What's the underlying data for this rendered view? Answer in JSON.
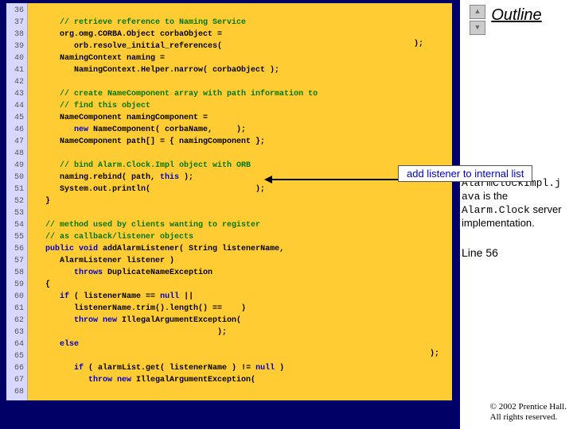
{
  "outline_label": "Outline",
  "gutter": "36\n37\n38\n39\n40\n41\n42\n43\n44\n45\n46\n47\n48\n49\n50\n51\n52\n53\n54\n55\n56\n57\n58\n59\n60\n61\n62\n63\n64\n65\n66\n67\n68",
  "callout_text": "add listener to internal list",
  "annotation_parts": {
    "p1": "AlarmClockImpl.j",
    "p2": "ava",
    "p3": " is the ",
    "p4": "Alarm.Clock",
    "p5": " server implementation."
  },
  "line_ref": "Line 56",
  "copyright_1": "© 2002 Prentice Hall.",
  "copyright_2": "All rights reserved.",
  "scroll_up": "▲",
  "scroll_down": "▼",
  "trail": ");",
  "trail2": ");",
  "code_lines": [
    {
      "pre": "",
      "cls": "",
      "txt": ""
    },
    {
      "pre": "      ",
      "cls": "cm",
      "txt": "// retrieve reference to Naming Service"
    },
    {
      "pre": "      ",
      "cls": "",
      "txt": "org.omg.CORBA.Object corbaObject ="
    },
    {
      "pre": "         ",
      "cls": "",
      "txt": "orb.resolve_initial_references("
    },
    {
      "pre": "      ",
      "cls": "",
      "txt": "NamingContext naming ="
    },
    {
      "pre": "         ",
      "cls": "",
      "txt": "NamingContext.Helper.narrow( corbaObject );"
    },
    {
      "pre": "",
      "cls": "",
      "txt": ""
    },
    {
      "pre": "      ",
      "cls": "cm",
      "txt": "// create NameComponent array with path information to"
    },
    {
      "pre": "      ",
      "cls": "cm",
      "txt": "// find this object"
    },
    {
      "pre": "      ",
      "cls": "",
      "txt": "NameComponent namingComponent ="
    },
    {
      "pre": "         ",
      "cls": "kw",
      "txt": "new ",
      "tail": "NameComponent( corbaName,     );"
    },
    {
      "pre": "      ",
      "cls": "",
      "txt": "NameComponent path[] = { namingComponent };"
    },
    {
      "pre": "",
      "cls": "",
      "txt": ""
    },
    {
      "pre": "      ",
      "cls": "cm",
      "txt": "// bind Alarm.Clock.Impl object with ORB"
    },
    {
      "pre": "      ",
      "cls": "",
      "txt": "naming.rebind( path, ",
      "kw": "this",
      "tail": " );"
    },
    {
      "pre": "      ",
      "cls": "",
      "txt": "System.out.println(                      );"
    },
    {
      "pre": "   ",
      "cls": "",
      "txt": "}"
    },
    {
      "pre": "",
      "cls": "",
      "txt": ""
    },
    {
      "pre": "   ",
      "cls": "cm",
      "txt": "// method used by clients wanting to register"
    },
    {
      "pre": "   ",
      "cls": "cm",
      "txt": "// as callback/listener objects"
    },
    {
      "pre": "   ",
      "cls": "kw",
      "txt": "public void ",
      "tail": "addAlarmListener( String listenerName,"
    },
    {
      "pre": "      ",
      "cls": "",
      "txt": "AlarmListener listener )"
    },
    {
      "pre": "         ",
      "cls": "kw",
      "txt": "throws ",
      "tail": "DuplicateNameException"
    },
    {
      "pre": "   ",
      "cls": "",
      "txt": "{"
    },
    {
      "pre": "      ",
      "cls": "kw",
      "txt": "if ",
      "tail": "( listenerName == ",
      "kw2": "null",
      " tail2": " ||"
    },
    {
      "pre": "         ",
      "cls": "",
      "txt": "listenerName.trim().length() ==    )"
    },
    {
      "pre": "         ",
      "cls": "kw",
      "txt": "throw new ",
      "tail": "IllegalArgumentException("
    },
    {
      "pre": "                                       ",
      "cls": "",
      "txt": ");"
    },
    {
      "pre": "      ",
      "cls": "kw",
      "txt": "else"
    },
    {
      "pre": "",
      "cls": "",
      "txt": ""
    },
    {
      "pre": "         ",
      "cls": "kw",
      "txt": "if ",
      "tail": "( alarmList.get( listenerName ) != ",
      "kw2": "null",
      "tail2": " )"
    },
    {
      "pre": "            ",
      "cls": "kw",
      "txt": "throw new ",
      "tail": "IllegalArgumentException("
    },
    {
      "pre": "",
      "cls": "",
      "txt": ""
    }
  ]
}
